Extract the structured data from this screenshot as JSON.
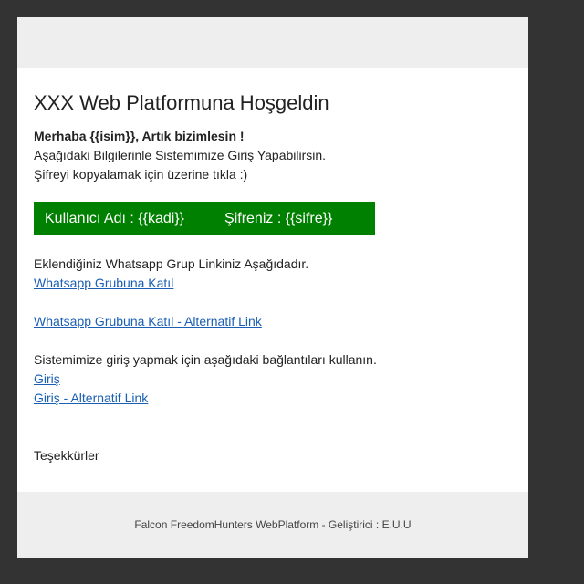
{
  "email": {
    "title": "XXX Web Platformuna Hoşgeldin",
    "greeting_bold": "Merhaba {{isim}}, Artık bizimlesin !",
    "greeting_line2": "Aşağıdaki Bilgilerinle Sistemimize Giriş Yapabilirsin.",
    "greeting_line3": "Şifreyi kopyalamak için üzerine tıkla :)",
    "credentials": {
      "username_text": "Kullanıcı Adı : {{kadi}}",
      "password_text": "Şifreniz : {{sifre}}",
      "background_color": "#008000"
    },
    "whatsapp_intro": "Eklendiğiniz Whatsapp Grup Linkiniz Aşağıdadır.",
    "whatsapp_link": "Whatsapp Grubuna Katıl ",
    "whatsapp_alt_link": "Whatsapp Grubuna Katıl - Alternatif Link",
    "login_intro": "Sistemimize giriş yapmak için aşağıdaki bağlantıları kullanın.",
    "login_link": "Giriş ",
    "login_alt_link": "Giriş - Alternatif Link",
    "thanks": "Teşekkürler",
    "footer": "Falcon FreedomHunters WebPlatform - Geliştirici : E.U.U"
  },
  "colors": {
    "page_background": "#333333",
    "band_background": "#eeeeee",
    "link": "#1a5fb4"
  }
}
